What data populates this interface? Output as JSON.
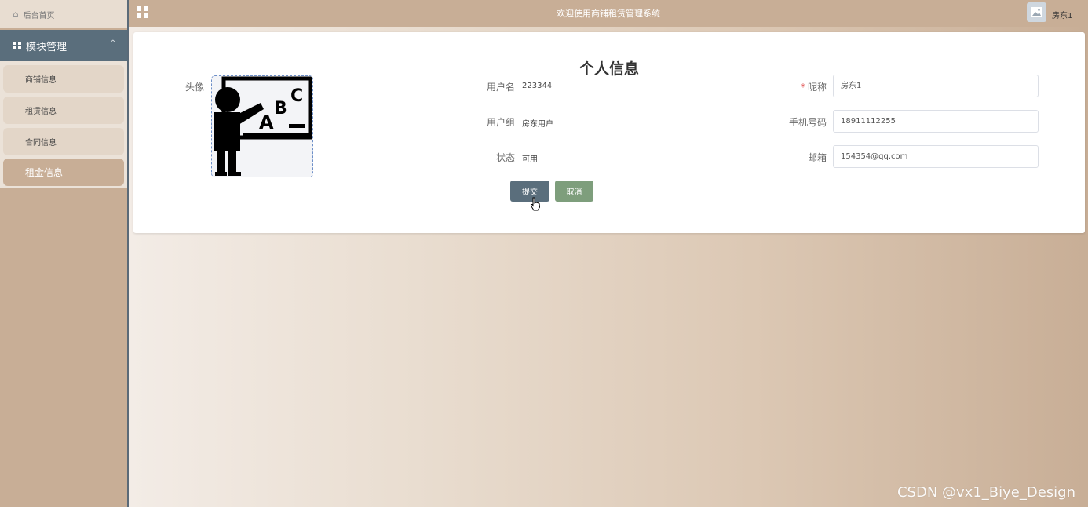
{
  "sidebar": {
    "home_label": "后台首页",
    "module_label": "模块管理",
    "items": [
      {
        "label": "商铺信息"
      },
      {
        "label": "租赁信息"
      },
      {
        "label": "合同信息"
      },
      {
        "label": "租金信息"
      }
    ]
  },
  "header": {
    "title": "欢迎使用商铺租赁管理系统",
    "username": "房东1"
  },
  "form": {
    "title": "个人信息",
    "avatar_label": "头像",
    "username_label": "用户名",
    "username_value": "223344",
    "group_label": "用户组",
    "group_value": "房东用户",
    "status_label": "状态",
    "status_value": "可用",
    "nickname_required": "*",
    "nickname_label": "昵称",
    "nickname_value": "房东1",
    "phone_label": "手机号码",
    "phone_value": "18911112255",
    "email_label": "邮箱",
    "email_value": "154354@qq.com",
    "avatar_letters": [
      "A",
      "B",
      "C"
    ]
  },
  "buttons": {
    "submit": "提交",
    "cancel": "取消"
  },
  "watermark": "CSDN @vx1_Biye_Design",
  "colors": {
    "sidebar": "#c8ae96",
    "module_header": "#5a6e7c",
    "submit": "#5a6e7c",
    "cancel": "#7e9e7c"
  }
}
